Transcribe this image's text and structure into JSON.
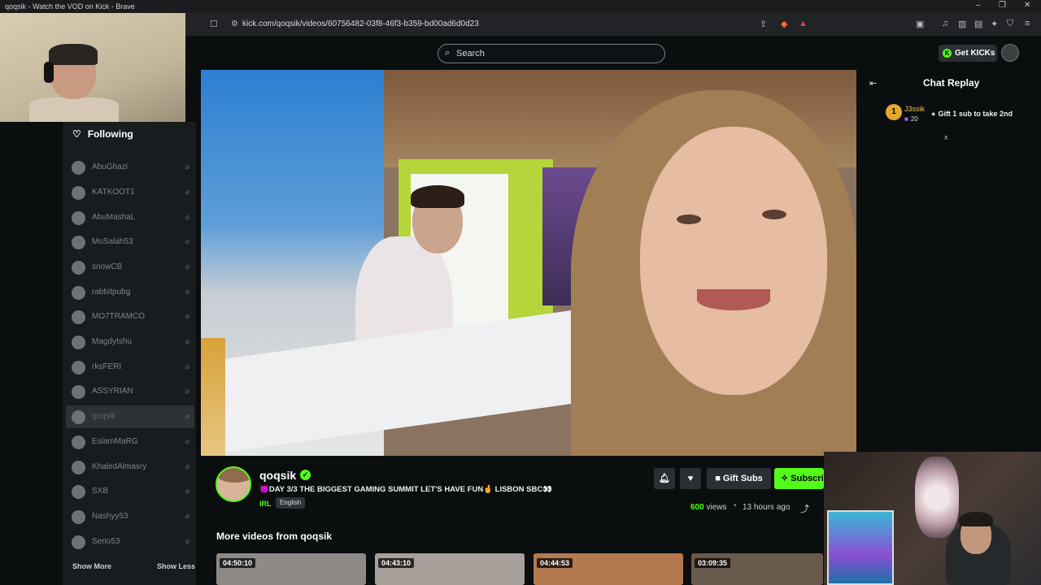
{
  "window": {
    "title": "qoqsik - Watch the VOD on Kick - Brave",
    "controls": [
      "–",
      "❐",
      "✕"
    ]
  },
  "browser": {
    "url": "kick.com/qoqsik/videos/60756482-03f8-46f3-b359-bd00ad6d0d23"
  },
  "header": {
    "search_placeholder": "Search",
    "get_kicks_label": "Get KICKs"
  },
  "sidebar": {
    "following_label": "Following",
    "items": [
      {
        "label": "AbuGhazi"
      },
      {
        "label": "KATKOOT1"
      },
      {
        "label": "AbuMashaL"
      },
      {
        "label": "MoSalah53"
      },
      {
        "label": "snowCB"
      },
      {
        "label": "rabbitpubg"
      },
      {
        "label": "MO7TRAMCO"
      },
      {
        "label": "Magdytshu"
      },
      {
        "label": "rksFERI"
      },
      {
        "label": "ASSYRIAN"
      },
      {
        "label": "qoqsik"
      },
      {
        "label": "EslamMaRG"
      },
      {
        "label": "KhaledAlmasry"
      },
      {
        "label": "SXB"
      },
      {
        "label": "Nashyy53"
      },
      {
        "label": "Serio53"
      }
    ],
    "show_more": "Show More",
    "show_less": "Show Less"
  },
  "chat": {
    "title": "Chat Replay",
    "pinned": {
      "rank": "1",
      "user": "J3ssik",
      "count": "20",
      "message": "Gift 1 sub to take 2nd"
    }
  },
  "channel": {
    "name": "qoqsik",
    "stream_title": "👿DAY 3/3 THE BIGGEST GAMING SUMMIT LET'S HAVE FUN🤞 LISBON SBC👀",
    "category": "IRL",
    "language": "English",
    "views_count": "600",
    "views_word": "views",
    "time_ago": "13 hours ago",
    "gift_subs_label": "Gift Subs",
    "subscribe_label": "Subscri"
  },
  "more_videos": {
    "header": "More videos from qoqsik",
    "items": [
      {
        "duration": "04:50:10",
        "color": "#8d8a86"
      },
      {
        "duration": "04:43:10",
        "color": "#a7a09a"
      },
      {
        "duration": "04:44:53",
        "color": "#b27a4e"
      },
      {
        "duration": "03:09:35",
        "color": "#6a5a4c"
      }
    ]
  },
  "colors": {
    "brand_green": "#53fc18",
    "background": "#0b0e0f",
    "sidebar": "#181c1e"
  }
}
